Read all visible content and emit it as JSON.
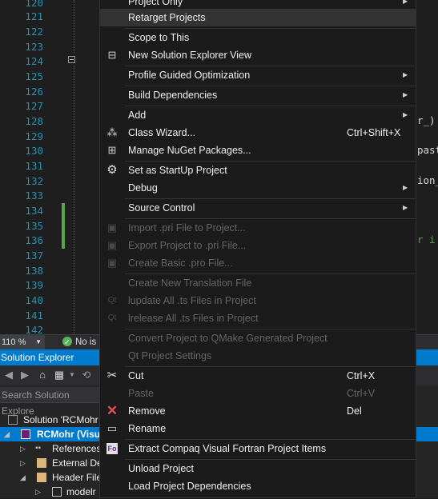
{
  "editor": {
    "line_numbers": [
      "120",
      "121",
      "122",
      "123",
      "124",
      "125",
      "126",
      "127",
      "128",
      "129",
      "130",
      "131",
      "132",
      "133",
      "134",
      "135",
      "136",
      "137",
      "138",
      "139",
      "140",
      "141",
      "142"
    ],
    "code_fragments": [
      "r_)",
      "past",
      "ion_",
      "r i"
    ]
  },
  "status": {
    "zoom": "110 %",
    "issues": "No is"
  },
  "solution_explorer": {
    "title": "Solution Explorer",
    "search_placeholder": "Search Solution Explore",
    "tree": [
      {
        "label": "Solution 'RCMohr"
      },
      {
        "label": "RCMohr (Visu"
      },
      {
        "label": "References"
      },
      {
        "label": "External De"
      },
      {
        "label": "Header File"
      },
      {
        "label": "modelr"
      }
    ]
  },
  "context_menu": {
    "items": [
      {
        "label": "Project Only",
        "arrow": true
      },
      {
        "label": "Retarget Projects"
      },
      {
        "label": "Scope to This"
      },
      {
        "label": "New Solution Explorer View",
        "icon": "new-view-icon"
      },
      {
        "label": "Profile Guided Optimization",
        "arrow": true
      },
      {
        "label": "Build Dependencies",
        "arrow": true
      },
      {
        "label": "Add",
        "arrow": true
      },
      {
        "label": "Class Wizard...",
        "shortcut": "Ctrl+Shift+X",
        "icon": "class-wizard-icon"
      },
      {
        "label": "Manage NuGet Packages...",
        "icon": "nuget-icon"
      },
      {
        "label": "Set as StartUp Project",
        "icon": "gear-icon"
      },
      {
        "label": "Debug",
        "arrow": true
      },
      {
        "label": "Source Control",
        "arrow": true
      },
      {
        "label": "Import .pri File to Project..."
      },
      {
        "label": "Export Project to .pri File..."
      },
      {
        "label": "Create Basic .pro File..."
      },
      {
        "label": "Create New Translation File"
      },
      {
        "label": "lupdate All .ts Files in Project"
      },
      {
        "label": "lrelease All .ts Files in Project"
      },
      {
        "label": "Convert Project to QMake Generated Project"
      },
      {
        "label": "Qt Project Settings"
      },
      {
        "label": "Cut",
        "shortcut": "Ctrl+X",
        "icon": "scissors-icon"
      },
      {
        "label": "Paste",
        "shortcut": "Ctrl+V"
      },
      {
        "label": "Remove",
        "shortcut": "Del",
        "icon": "remove-x-icon"
      },
      {
        "label": "Rename",
        "icon": "rename-icon"
      },
      {
        "label": "Extract Compaq Visual Fortran Project Items",
        "icon": "fortran-icon"
      },
      {
        "label": "Unload Project"
      },
      {
        "label": "Load Project Dependencies"
      }
    ]
  },
  "colors": {
    "accent": "#007acc",
    "line_number": "#2b91af",
    "change_bar": "#57a64a",
    "remove_icon": "#e05252"
  }
}
